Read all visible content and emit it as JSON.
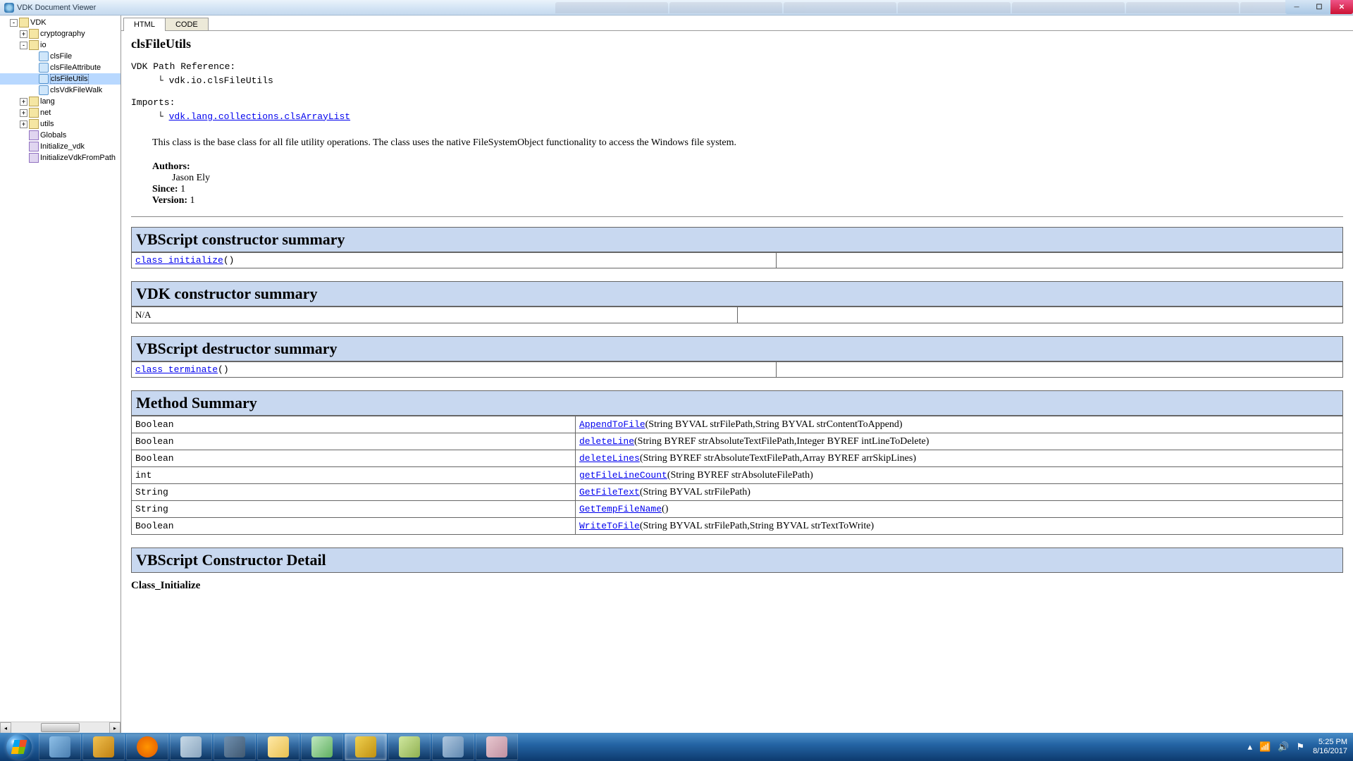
{
  "window": {
    "title": "VDK Document Viewer"
  },
  "tree": {
    "root": "VDK",
    "cryptography": "cryptography",
    "io": "io",
    "clsFile": "clsFile",
    "clsFileAttribute": "clsFileAttribute",
    "clsFileUtils": "clsFileUtils",
    "clsVdkFileWalk": "clsVdkFileWalk",
    "lang": "lang",
    "net": "net",
    "utils": "utils",
    "Globals": "Globals",
    "Initialize_vdk": "Initialize_vdk",
    "InitializeVdkFromPath": "InitializeVdkFromPath"
  },
  "tabs": {
    "html": "HTML",
    "code": "CODE"
  },
  "doc": {
    "className": "clsFileUtils",
    "pathRefLabel": "VDK Path Reference:",
    "pathRefValue": "vdk.io.clsFileUtils",
    "importsLabel": "Imports:",
    "importLink": "vdk.lang.collections.clsArrayList",
    "description": "This class is the base class for all file utility operations. The class uses the native FileSystemObject functionality to access the Windows file system.",
    "authorsLabel": "Authors:",
    "author": "Jason Ely",
    "sinceLabel": "Since:",
    "sinceValue": "1",
    "versionLabel": "Version:",
    "versionValue": "1",
    "sections": {
      "vbConstructor": "VBScript constructor summary",
      "vdkConstructor": "VDK constructor summary",
      "vbDestructor": "VBScript destructor summary",
      "methodSummary": "Method Summary",
      "vbConstructorDetail": "VBScript Constructor Detail"
    },
    "vbConstructorRow": {
      "name": "class_initialize",
      "suffix": "()"
    },
    "vdkConstructorRow": {
      "na": "N/A"
    },
    "vbDestructorRow": {
      "name": "class_terminate",
      "suffix": "()"
    },
    "methods": [
      {
        "ret": "Boolean",
        "name": "AppendToFile",
        "params": "(String BYVAL strFilePath,String BYVAL strContentToAppend)"
      },
      {
        "ret": "Boolean",
        "name": "deleteLine",
        "params": "(String BYREF strAbsoluteTextFilePath,Integer BYREF intLineToDelete)"
      },
      {
        "ret": "Boolean",
        "name": "deleteLines",
        "params": "(String BYREF strAbsoluteTextFilePath,Array BYREF arrSkipLines)"
      },
      {
        "ret": "int",
        "name": "getFileLineCount",
        "params": "(String BYREF strAbsoluteFilePath)"
      },
      {
        "ret": "String",
        "name": "GetFileText",
        "params": "(String BYVAL strFilePath)"
      },
      {
        "ret": "String",
        "name": "GetTempFileName",
        "params": "()"
      },
      {
        "ret": "Boolean",
        "name": "WriteToFile",
        "params": "(String BYVAL strFilePath,String BYVAL strTextToWrite)"
      }
    ],
    "detailName": "Class_Initialize"
  },
  "taskbar": {
    "time": "5:25 PM",
    "date": "8/16/2017"
  }
}
